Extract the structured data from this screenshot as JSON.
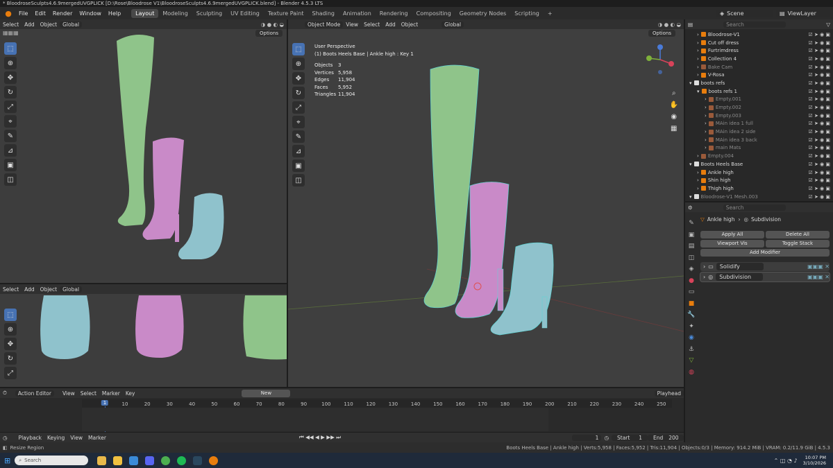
{
  "window": {
    "title": "* BloodroseSculpts4.6.9mergedUVGPLICK [D:\\Rose\\Bloodrose V1\\BloodroseSculpts4.6.9mergedUVGPLICK.blend] - Blender 4.5.3 LTS"
  },
  "menu": {
    "items": [
      "File",
      "Edit",
      "Render",
      "Window",
      "Help"
    ]
  },
  "workspaces": [
    "Layout",
    "Modeling",
    "Sculpting",
    "UV Editing",
    "Texture Paint",
    "Shading",
    "Animation",
    "Rendering",
    "Compositing",
    "Geometry Nodes",
    "Scripting"
  ],
  "scene": {
    "name": "Scene",
    "view_layer": "ViewLayer"
  },
  "vp_header": {
    "select": "Select",
    "add": "Add",
    "object": "Object",
    "orientation": "Global",
    "options": "Options",
    "mode": "Object Mode",
    "view": "View"
  },
  "overlay": {
    "perspective": "User Perspective",
    "context": "(1) Boots Heels Base | Ankle high : Key 1",
    "stats": [
      {
        "k": "Objects",
        "v": "3"
      },
      {
        "k": "Vertices",
        "v": "5,958"
      },
      {
        "k": "Edges",
        "v": "11,904"
      },
      {
        "k": "Faces",
        "v": "5,952"
      },
      {
        "k": "Triangles",
        "v": "11,904"
      }
    ]
  },
  "outliner": {
    "search_placeholder": "Search",
    "rows": [
      {
        "label": "Bloodrose-V1",
        "indent": 1,
        "faded": false
      },
      {
        "label": "Cut off dress",
        "indent": 1,
        "faded": false
      },
      {
        "label": "Furtrimdress",
        "indent": 1,
        "faded": false
      },
      {
        "label": "Collection 4",
        "indent": 1,
        "faded": false
      },
      {
        "label": "Bake Cam",
        "indent": 1,
        "faded": true
      },
      {
        "label": "V-Rosa",
        "indent": 1,
        "faded": false
      },
      {
        "label": "boots refs",
        "indent": 0,
        "faded": false
      },
      {
        "label": "boots refs 1",
        "indent": 1,
        "faded": false
      },
      {
        "label": "Empty.001",
        "indent": 2,
        "faded": true
      },
      {
        "label": "Empty.002",
        "indent": 2,
        "faded": true
      },
      {
        "label": "Empty.003",
        "indent": 2,
        "faded": true
      },
      {
        "label": "MAin idea 1 full",
        "indent": 2,
        "faded": true
      },
      {
        "label": "MAin idea 2 side",
        "indent": 2,
        "faded": true
      },
      {
        "label": "MAin idea 3 back",
        "indent": 2,
        "faded": true
      },
      {
        "label": "main Mats",
        "indent": 2,
        "faded": true
      },
      {
        "label": "Empty.004",
        "indent": 1,
        "faded": true
      },
      {
        "label": "Boots Heels Base",
        "indent": 0,
        "faded": false
      },
      {
        "label": "Ankle high",
        "indent": 1,
        "faded": false
      },
      {
        "label": "Shin high",
        "indent": 1,
        "faded": false
      },
      {
        "label": "Thigh high",
        "indent": 1,
        "faded": false
      },
      {
        "label": "Bloodrose-V1 Mesh.003",
        "indent": 0,
        "faded": true
      }
    ]
  },
  "properties": {
    "search_placeholder": "Search",
    "object": "Ankle high",
    "modifier_context": "Subdivision",
    "apply_all": "Apply All",
    "delete_all": "Delete All",
    "viewport_vis": "Viewport Vis",
    "toggle_stack": "Toggle Stack",
    "add_modifier": "Add Modifier",
    "modifiers": [
      "Solidify",
      "Subdivision"
    ]
  },
  "action_editor": {
    "mode": "Action Editor",
    "view": "View",
    "select": "Select",
    "marker": "Marker",
    "key": "Key",
    "new": "New",
    "playhead": "Playhead"
  },
  "timeline": {
    "current_frame": "1",
    "ticks": [
      "10",
      "20",
      "30",
      "40",
      "50",
      "60",
      "70",
      "80",
      "90",
      "100",
      "110",
      "120",
      "130",
      "140",
      "150",
      "160",
      "170",
      "180",
      "190",
      "200",
      "210",
      "220",
      "230",
      "240",
      "250"
    ],
    "playback": "Playback",
    "keying": "Keying",
    "view": "View",
    "marker": "Marker",
    "frame": "1",
    "start_label": "Start",
    "start": "1",
    "end_label": "End",
    "end": "200"
  },
  "statusbar": {
    "left": "Resize Region",
    "right": "Boots Heels Base | Ankle high | Verts:5,958 | Faces:5,952 | Tris:11,904 | Objects:0/3 | Memory: 914.2 MiB | VRAM: 0.2/11.9 GiB | 4.5.3"
  },
  "taskbar": {
    "search_placeholder": "Search",
    "time": "10:07 PM",
    "date": "3/10/2026"
  },
  "colors": {
    "accent": "#4772b3",
    "boot_green": "#8fc48a",
    "boot_pink": "#c98ac8",
    "boot_blue": "#8fc2cc",
    "wire": "#5fd6d6"
  }
}
